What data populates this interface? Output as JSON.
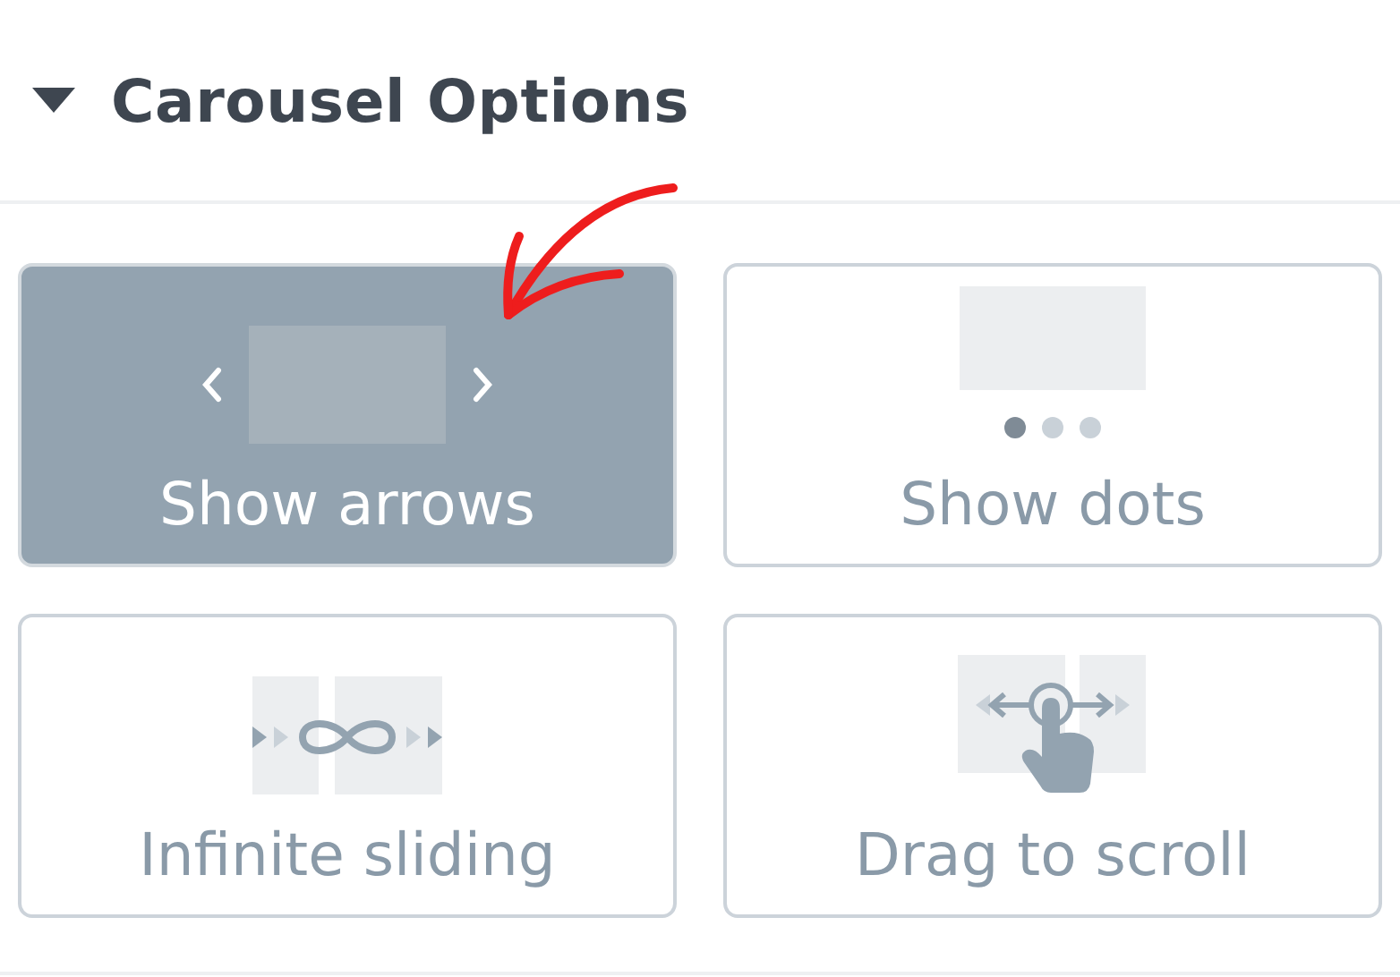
{
  "section": {
    "title": "Carousel Options",
    "expanded": true
  },
  "options": [
    {
      "kind": "arrows",
      "label": "Show arrows",
      "selected": true
    },
    {
      "kind": "dots",
      "label": "Show dots",
      "selected": false
    },
    {
      "kind": "infinite",
      "label": "Infinite sliding",
      "selected": false
    },
    {
      "kind": "drag",
      "label": "Drag to scroll",
      "selected": false
    }
  ]
}
